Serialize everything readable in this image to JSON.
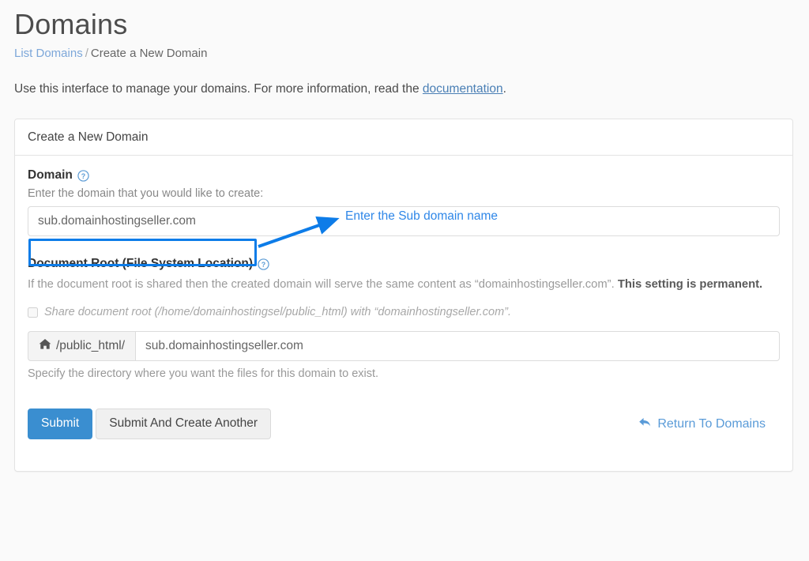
{
  "header": {
    "title": "Domains",
    "breadcrumb": {
      "link_label": "List Domains",
      "separator": "/",
      "current_label": "Create a New Domain"
    },
    "intro_before": "Use this interface to manage your domains. For more information, read the ",
    "intro_link": "documentation",
    "intro_after": "."
  },
  "card": {
    "header_title": "Create a New Domain",
    "domain_field": {
      "label": "Domain",
      "help_icon": "question-circle-icon",
      "hint": "Enter the domain that you would like to create:",
      "value": "sub.domainhostingseller.com",
      "placeholder": "sub.domainhostingseller.com"
    },
    "document_root": {
      "label": "Document Root (File System Location)",
      "help_icon": "question-circle-icon",
      "description_part1": "If the document root is shared then the created domain will serve the same content as “domainhostingseller.com”. ",
      "description_bold": "This setting is permanent.",
      "share_checkbox": {
        "checked": false,
        "label": "Share document root (/home/domainhostingsel/public_html) with “domainhostingseller.com”."
      },
      "path_addon_icon": "home-icon",
      "path_addon_label": "/public_html/",
      "value": "sub.domainhostingseller.com",
      "placeholder": "sub.domainhostingseller.com",
      "help_block": "Specify the directory where you want the files for this domain to exist."
    },
    "actions": {
      "submit_label": "Submit",
      "submit_another_label": "Submit And Create Another",
      "return_label": "Return To Domains",
      "return_icon": "arrow-back-icon"
    }
  },
  "annotations": {
    "callout_text": "Enter the Sub domain name",
    "highlight_color": "#0d7ce8",
    "callout_color": "#2f87e8"
  }
}
